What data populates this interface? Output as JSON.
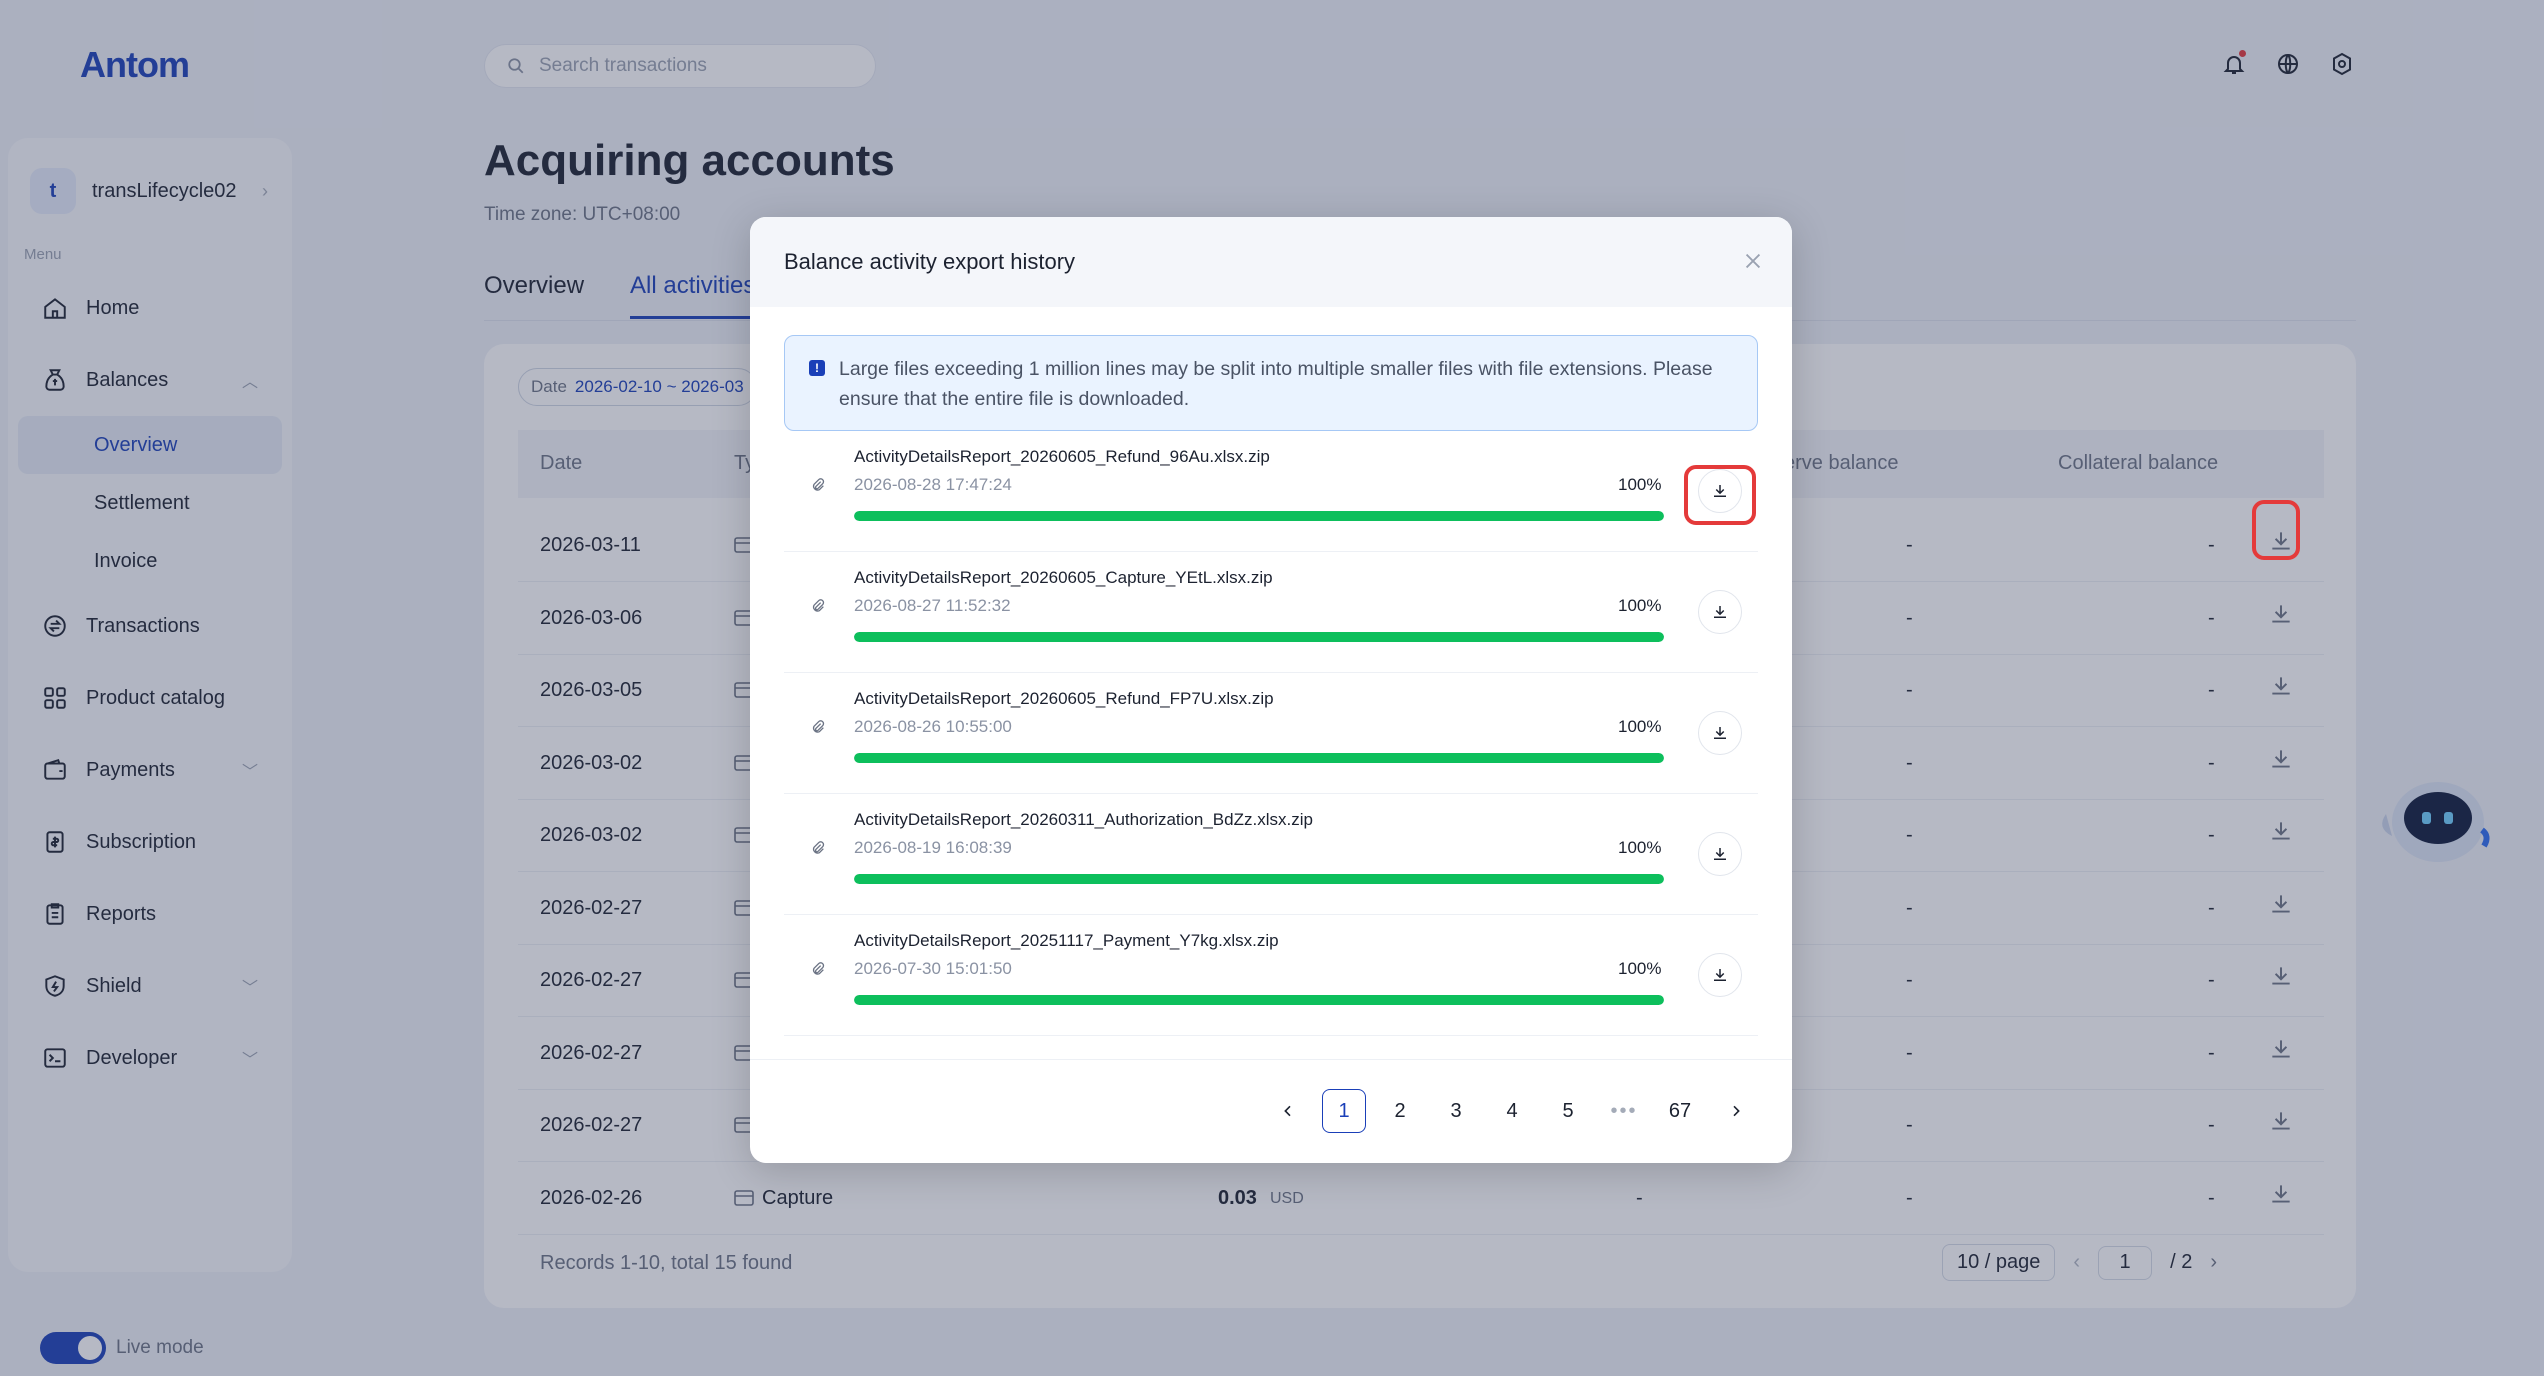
{
  "app": {
    "logo": "Antom",
    "search_placeholder": "Search transactions"
  },
  "sidebar": {
    "account_initial": "t",
    "account_name": "transLifecycle02",
    "menu_label": "Menu",
    "items": [
      {
        "label": "Home",
        "icon": "home-icon"
      },
      {
        "label": "Balances",
        "icon": "balance-icon"
      },
      {
        "label": "Transactions",
        "icon": "transactions-icon"
      },
      {
        "label": "Product catalog",
        "icon": "catalog-icon"
      },
      {
        "label": "Payments",
        "icon": "wallet-icon"
      },
      {
        "label": "Subscription",
        "icon": "subscription-icon"
      },
      {
        "label": "Reports",
        "icon": "reports-icon"
      },
      {
        "label": "Shield",
        "icon": "shield-icon"
      },
      {
        "label": "Developer",
        "icon": "terminal-icon"
      }
    ],
    "balances_sub": [
      "Overview",
      "Settlement",
      "Invoice"
    ],
    "live_mode": "Live mode"
  },
  "page": {
    "title": "Acquiring accounts",
    "timezone": "Time zone: UTC+08:00",
    "tabs": [
      "Overview",
      "All activities"
    ],
    "date_filter_label": "Date",
    "date_filter_value": "2026-02-10 ~ 2026-03",
    "columns": {
      "date": "Date",
      "type": "Ty",
      "reserve": "serve balance",
      "collateral": "Collateral balance"
    },
    "rows": [
      {
        "date": "2026-03-11"
      },
      {
        "date": "2026-03-06"
      },
      {
        "date": "2026-03-05"
      },
      {
        "date": "2026-03-02"
      },
      {
        "date": "2026-03-02"
      },
      {
        "date": "2026-02-27"
      },
      {
        "date": "2026-02-27"
      },
      {
        "date": "2026-02-27"
      },
      {
        "date": "2026-02-27"
      },
      {
        "date": "2026-02-26",
        "type": "Capture",
        "amount": "0.03",
        "currency": "USD"
      }
    ],
    "dash": "-",
    "records": "Records 1-10, total 15 found",
    "page_size": "10 / page",
    "page_input": "1",
    "page_total": "/  2"
  },
  "modal": {
    "title": "Balance activity export history",
    "notice": "Large files exceeding 1 million lines may be split into multiple smaller files with file extensions. Please ensure that the entire file is downloaded.",
    "files": [
      {
        "name": "ActivityDetailsReport_20260605_Refund_96Au.xlsx.zip",
        "date": "2026-08-28 17:47:24",
        "progress": "100%",
        "fraction": 1.0
      },
      {
        "name": "ActivityDetailsReport_20260605_Capture_YEtL.xlsx.zip",
        "date": "2026-08-27 11:52:32",
        "progress": "100%",
        "fraction": 1.0
      },
      {
        "name": "ActivityDetailsReport_20260605_Refund_FP7U.xlsx.zip",
        "date": "2026-08-26 10:55:00",
        "progress": "100%",
        "fraction": 1.0
      },
      {
        "name": "ActivityDetailsReport_20260311_Authorization_BdZz.xlsx.zip",
        "date": "2026-08-19 16:08:39",
        "progress": "100%",
        "fraction": 1.0
      },
      {
        "name": "ActivityDetailsReport_20251117_Payment_Y7kg.xlsx.zip",
        "date": "2026-07-30 15:01:50",
        "progress": "100%",
        "fraction": 1.0
      }
    ],
    "pagination": [
      "1",
      "2",
      "3",
      "4",
      "5",
      "•••",
      "67"
    ],
    "current_page": "1"
  },
  "colors": {
    "accent": "#1a3fb8",
    "progress": "#0dbf5c",
    "highlight": "#e43a3a"
  }
}
